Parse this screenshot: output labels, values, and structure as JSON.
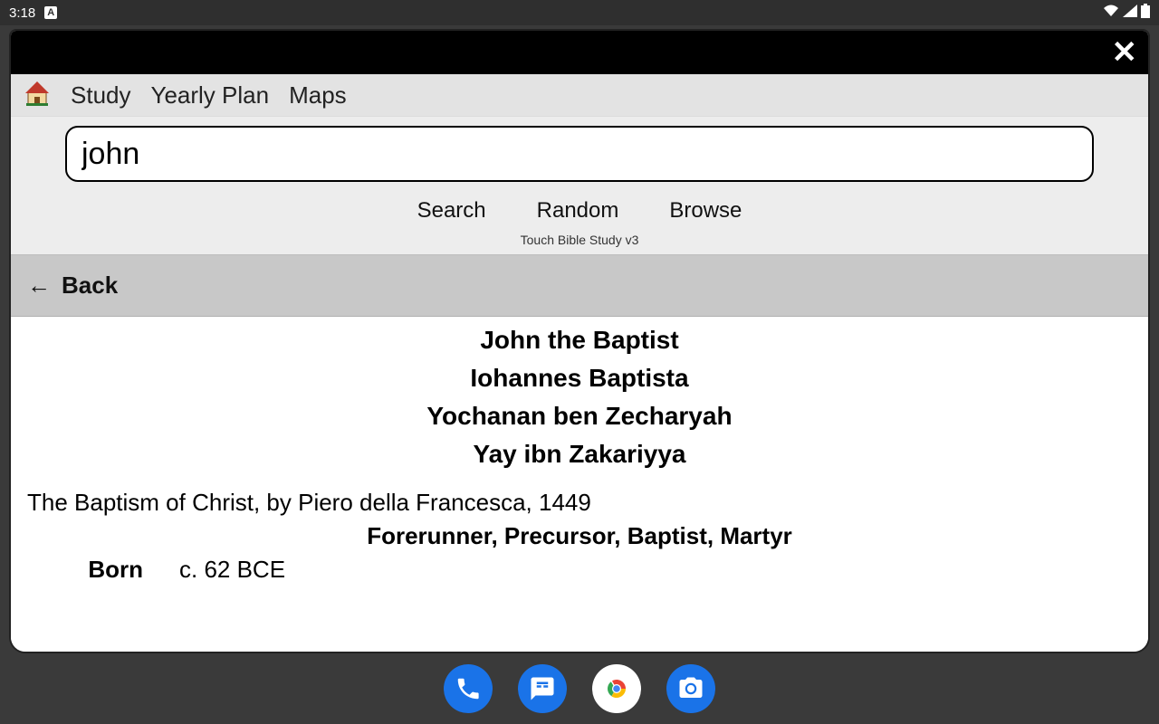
{
  "status": {
    "time": "3:18",
    "icon_a": "A"
  },
  "nav": {
    "study": "Study",
    "yearly_plan": "Yearly Plan",
    "maps": "Maps"
  },
  "search": {
    "value": "john",
    "search_label": "Search",
    "random_label": "Random",
    "browse_label": "Browse",
    "version": "Touch Bible Study v3"
  },
  "back": {
    "arrow": "←",
    "label": "Back"
  },
  "article": {
    "heading1": "John the Baptist",
    "heading2": "Iohannes Baptista",
    "heading3": "Yochanan ben Zecharyah",
    "heading4": "Yay ibn Zakariyya",
    "caption": "The Baptism of Christ, by Piero della Francesca, 1449",
    "titles": "Forerunner, Precursor, Baptist, Martyr",
    "born_label": "Born",
    "born_value": "c. 62 BCE"
  }
}
